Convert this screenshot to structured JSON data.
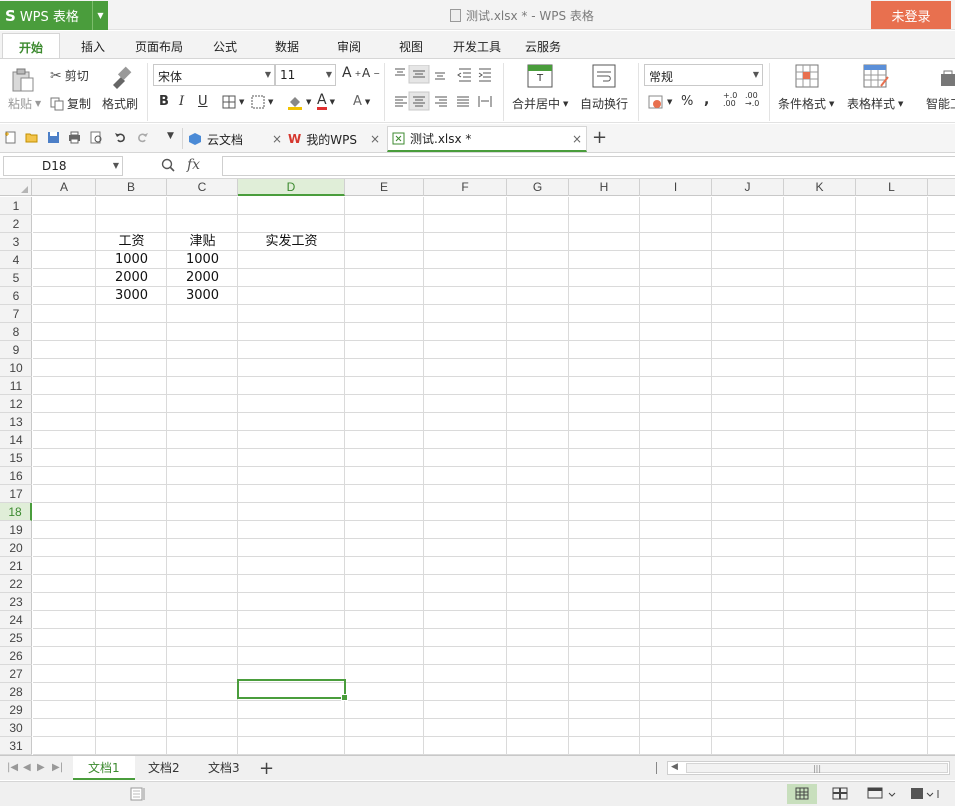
{
  "titlebar": {
    "app_logo": "S",
    "app_name": "WPS 表格",
    "doc_title": "测试.xlsx * - WPS 表格",
    "login": "未登录"
  },
  "menu": [
    "开始",
    "插入",
    "页面布局",
    "公式",
    "数据",
    "审阅",
    "视图",
    "开发工具",
    "云服务"
  ],
  "ribbon": {
    "paste": "粘贴",
    "cut": "剪切",
    "copy": "复制",
    "format_painter": "格式刷",
    "font_name": "宋体",
    "font_size": "11",
    "merge_center": "合并居中",
    "wrap_text": "自动换行",
    "number_format": "常规",
    "conditional_format": "条件格式",
    "table_style": "表格样式",
    "smart_tool": "智能工"
  },
  "quickbar": {
    "tabs": [
      {
        "label": "云文档",
        "icon": "cloud-doc-icon"
      },
      {
        "label": "我的WPS",
        "icon": "wps-icon"
      },
      {
        "label": "测试.xlsx *",
        "icon": "sheet-file-icon"
      }
    ],
    "close": "×",
    "add": "+"
  },
  "formula": {
    "name_box": "D18",
    "fx": "fx",
    "value": ""
  },
  "columns": [
    "A",
    "B",
    "C",
    "D",
    "E",
    "F",
    "G",
    "H",
    "I",
    "J",
    "K",
    "L"
  ],
  "selected_column": "D",
  "rows": [
    "1",
    "2",
    "3",
    "4",
    "5",
    "6",
    "7",
    "8",
    "9",
    "10",
    "11",
    "12",
    "13",
    "14",
    "15",
    "16",
    "17",
    "18",
    "19",
    "20",
    "21",
    "22",
    "23",
    "24",
    "25",
    "26",
    "27",
    "28",
    "29",
    "30",
    "31"
  ],
  "selected_row": "18",
  "table": {
    "headers": [
      "工资",
      "津贴",
      "实发工资"
    ],
    "rows": [
      [
        "1000",
        "1000",
        ""
      ],
      [
        "2000",
        "2000",
        ""
      ],
      [
        "3000",
        "3000",
        ""
      ]
    ]
  },
  "sheets": [
    "文档1",
    "文档2",
    "文档3"
  ],
  "active_sheet": "文档1",
  "colors": {
    "accent_green": "#4a9d3c",
    "login_orange": "#e8704f"
  }
}
